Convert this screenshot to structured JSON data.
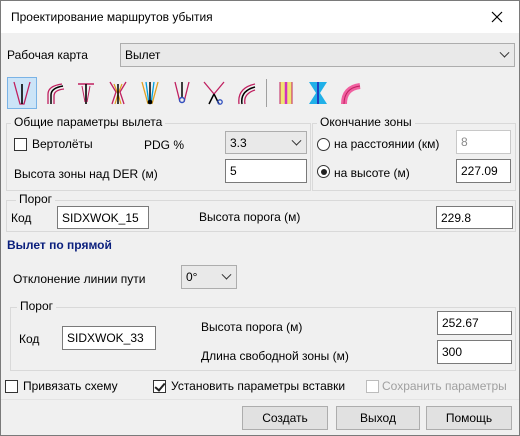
{
  "window": {
    "title": "Проектирование маршрутов убытия",
    "close_icon": "close-icon"
  },
  "work_map": {
    "label": "Рабочая карта",
    "value": "Вылет"
  },
  "toolbar": {
    "icons": [
      "departure-straight-icon",
      "departure-turn-icon",
      "departure-altitude-icon",
      "departure-multi-turn-icon",
      "departure-zone-icon",
      "departure-point-icon",
      "departure-split-icon",
      "departure-curve-icon",
      "profile-pink-icon",
      "profile-cyan-icon",
      "arc-pink-icon"
    ]
  },
  "general": {
    "title": "Общие параметры вылета",
    "heli_label": "Вертолёты",
    "pdg_label": "PDG %",
    "pdg_value": "3.3",
    "zone_height_label": "Высота зоны над DER (м)",
    "zone_height_value": "5"
  },
  "zone_end": {
    "title": "Окончание зоны",
    "distance_label": "на расстоянии (км)",
    "distance_value": "8",
    "altitude_label": "на высоте (м)",
    "altitude_value": "227.09"
  },
  "threshold1": {
    "title": "Порог",
    "code_label": "Код",
    "code_value": "SIDXWOK_15",
    "height_label": "Высота порога (м)",
    "height_value": "229.8"
  },
  "straight": {
    "title": "Вылет по прямой",
    "deviation_label": "Отклонение линии пути",
    "deviation_value": "0°"
  },
  "threshold2": {
    "title": "Порог",
    "code_label": "Код",
    "code_value": "SIDXWOK_33",
    "height_label": "Высота порога (м)",
    "height_value": "252.67",
    "free_zone_label": "Длина свободной зоны (м)",
    "free_zone_value": "300"
  },
  "options": {
    "bind_scheme": "Привязать схему",
    "set_insert": "Установить параметры вставки",
    "save_params": "Сохранить параметры"
  },
  "buttons": {
    "create": "Создать",
    "exit": "Выход",
    "help": "Помощь"
  }
}
